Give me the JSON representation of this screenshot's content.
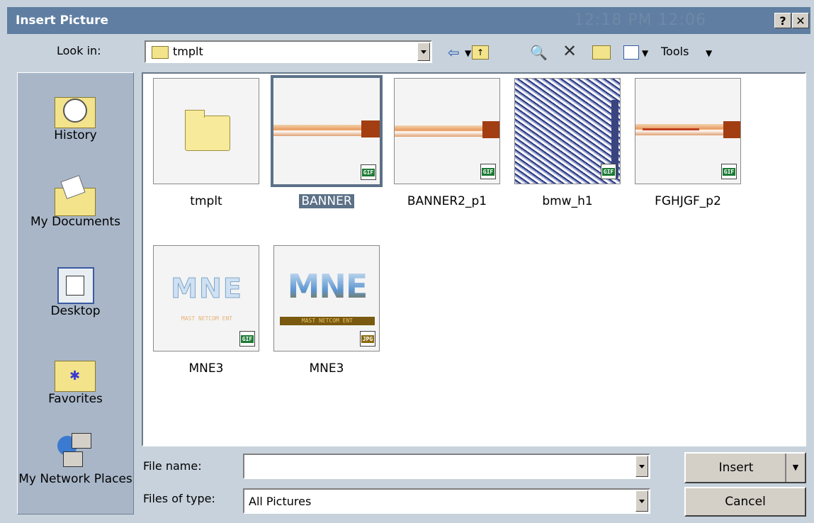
{
  "dialog": {
    "title": "Insert Picture",
    "clock": "12:18 PM 12:06",
    "help_label": "?",
    "close_label": "✕"
  },
  "toolbar": {
    "lookin_label": "Look in:",
    "lookin_value": "tmplt",
    "tools_label": "Tools"
  },
  "places": [
    {
      "label": "History",
      "icon": "history-icon"
    },
    {
      "label": "My Documents",
      "icon": "my-documents-icon"
    },
    {
      "label": "Desktop",
      "icon": "desktop-icon"
    },
    {
      "label": "Favorites",
      "icon": "favorites-icon"
    },
    {
      "label": "My Network Places",
      "icon": "network-places-icon"
    }
  ],
  "files": [
    {
      "name": "tmplt",
      "type": "folder",
      "selected": false
    },
    {
      "name": "BANNER",
      "type": "GIF",
      "selected": true
    },
    {
      "name": "BANNER2_p1",
      "type": "GIF",
      "selected": false
    },
    {
      "name": "bmw_h1",
      "type": "GIF",
      "selected": false
    },
    {
      "name": "FGHJGF_p2",
      "type": "GIF",
      "selected": false
    },
    {
      "name": "MNE3",
      "type": "GIF",
      "selected": false
    },
    {
      "name": "MNE3",
      "type": "JPG",
      "selected": false
    }
  ],
  "thumb_text": {
    "mne": "MNE",
    "mne_sub": "MAST NETCOM ENT"
  },
  "form": {
    "filename_label": "File name:",
    "filename_value": "",
    "filetype_label": "Files of type:",
    "filetype_value": "All Pictures"
  },
  "buttons": {
    "insert_label": "Insert",
    "cancel_label": "Cancel"
  },
  "colors": {
    "titlebar": "#5f7ea1",
    "selection": "#5c7188",
    "dialog_bg": "#c7d2dc"
  }
}
